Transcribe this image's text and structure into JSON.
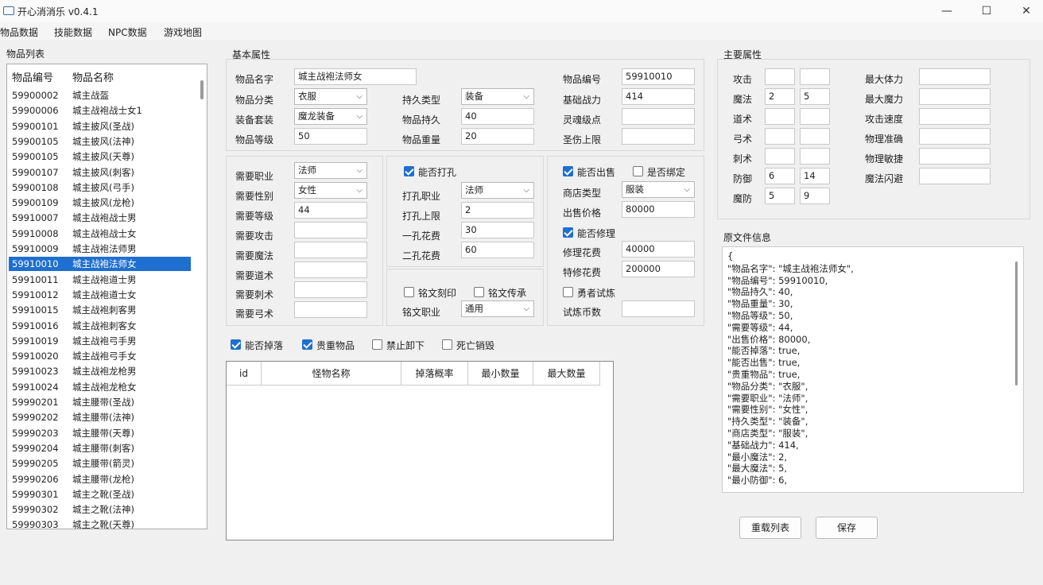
{
  "window": {
    "title": "开心消消乐 v0.4.1",
    "minimize": "—",
    "maximize": "☐",
    "close": "✕"
  },
  "menu": [
    "物品数据",
    "技能数据",
    "NPC数据",
    "游戏地图"
  ],
  "item_list": {
    "title": "物品列表",
    "headers": [
      "物品编号",
      "物品名称"
    ],
    "rows": [
      [
        "59900002",
        "城主战盔"
      ],
      [
        "59900006",
        "城主战袍战士女1"
      ],
      [
        "59900101",
        "城主披风(圣战)"
      ],
      [
        "59900105",
        "城主披风(法神)"
      ],
      [
        "59900105",
        "城主披风(天尊)"
      ],
      [
        "59900107",
        "城主披风(刺客)"
      ],
      [
        "59900108",
        "城主披风(弓手)"
      ],
      [
        "59900109",
        "城主披风(龙枪)"
      ],
      [
        "59910007",
        "城主战袍战士男"
      ],
      [
        "59910008",
        "城主战袍战士女"
      ],
      [
        "59910009",
        "城主战袍法师男"
      ],
      [
        "59910010",
        "城主战袍法师女"
      ],
      [
        "59910011",
        "城主战袍道士男"
      ],
      [
        "59910012",
        "城主战袍道士女"
      ],
      [
        "59910015",
        "城主战袍刺客男"
      ],
      [
        "59910016",
        "城主战袍刺客女"
      ],
      [
        "59910019",
        "城主战袍弓手男"
      ],
      [
        "59910020",
        "城主战袍弓手女"
      ],
      [
        "59910023",
        "城主战袍龙枪男"
      ],
      [
        "59910024",
        "城主战袍龙枪女"
      ],
      [
        "59990201",
        "城主腰带(圣战)"
      ],
      [
        "59990202",
        "城主腰带(法神)"
      ],
      [
        "59990203",
        "城主腰带(天尊)"
      ],
      [
        "59990204",
        "城主腰带(刺客)"
      ],
      [
        "59990205",
        "城主腰带(箭灵)"
      ],
      [
        "59990206",
        "城主腰带(龙枪)"
      ],
      [
        "59990301",
        "城主之靴(圣战)"
      ],
      [
        "59990302",
        "城主之靴(法神)"
      ],
      [
        "59990303",
        "城主之靴(天尊)"
      ]
    ],
    "selected_index": 11
  },
  "basic": {
    "title": "基本属性",
    "name_label": "物品名字",
    "name_value": "城主战袍法师女",
    "id_label": "物品编号",
    "id_value": "59910010",
    "category_label": "物品分类",
    "category_value": "衣服",
    "durability_type_label": "持久类型",
    "durability_type_value": "装备",
    "base_power_label": "基础战力",
    "base_power_value": "414",
    "equip_set_label": "装备套装",
    "equip_set_value": "魔龙装备",
    "durability_label": "物品持久",
    "durability_value": "40",
    "soul_label": "灵魂级点",
    "soul_value": "",
    "level_label": "物品等级",
    "level_value": "50",
    "weight_label": "物品重量",
    "weight_value": "20",
    "holy_label": "圣伤上限",
    "holy_value": ""
  },
  "req": {
    "job_label": "需要职业",
    "job_value": "法师",
    "gender_label": "需要性别",
    "gender_value": "女性",
    "level_label": "需要等级",
    "level_value": "44",
    "atk_label": "需要攻击",
    "atk_value": "",
    "magic_label": "需要魔法",
    "magic_value": "",
    "tao_label": "需要道术",
    "tao_value": "",
    "stab_label": "需要刺术",
    "stab_value": "",
    "bow_label": "需要弓术",
    "bow_value": ""
  },
  "socket": {
    "can_punch_label": "能否打孔",
    "punch_job_label": "打孔职业",
    "punch_job_value": "法师",
    "punch_max_label": "打孔上限",
    "punch_max_value": "2",
    "one_cost_label": "一孔花费",
    "one_cost_value": "30",
    "two_cost_label": "二孔花费",
    "two_cost_value": "60"
  },
  "inscription": {
    "engrave_label": "铭文刻印",
    "inherit_label": "铭文传承",
    "job_label": "铭文职业",
    "job_value": "通用"
  },
  "shop": {
    "can_sell_label": "能否出售",
    "is_bound_label": "是否绑定",
    "type_label": "商店类型",
    "type_value": "服装",
    "price_label": "出售价格",
    "price_value": "80000",
    "can_repair_label": "能否修理",
    "repair_cost_label": "修理花费",
    "repair_cost_value": "40000",
    "special_repair_label": "特修花费",
    "special_repair_value": "200000",
    "trial_label": "勇者试炼",
    "trial_coin_label": "试炼币数",
    "trial_coin_value": ""
  },
  "flags": {
    "drop": "能否掉落",
    "valuable": "贵重物品",
    "no_unequip": "禁止卸下",
    "death_destroy": "死亡销毁"
  },
  "drop_table": {
    "headers": [
      "id",
      "怪物名称",
      "掉落概率",
      "最小数量",
      "最大数量"
    ]
  },
  "main_attr": {
    "title": "主要属性",
    "rows": [
      {
        "label": "攻击",
        "a": "",
        "b": ""
      },
      {
        "label": "魔法",
        "a": "2",
        "b": "5"
      },
      {
        "label": "道术",
        "a": "",
        "b": ""
      },
      {
        "label": "弓术",
        "a": "",
        "b": ""
      },
      {
        "label": "刺术",
        "a": "",
        "b": ""
      },
      {
        "label": "防御",
        "a": "6",
        "b": "14"
      },
      {
        "label": "魔防",
        "a": "5",
        "b": "9"
      }
    ],
    "right": [
      {
        "label": "最大体力",
        "v": ""
      },
      {
        "label": "最大魔力",
        "v": ""
      },
      {
        "label": "攻击速度",
        "v": ""
      },
      {
        "label": "物理准确",
        "v": ""
      },
      {
        "label": "物理敏捷",
        "v": ""
      },
      {
        "label": "魔法闪避",
        "v": ""
      }
    ]
  },
  "source": {
    "title": "原文件信息",
    "lines": [
      "{",
      "  \"物品名字\": \"城主战袍法师女\",",
      "  \"物品编号\": 59910010,",
      "  \"物品持久\": 40,",
      "  \"物品重量\": 30,",
      "  \"物品等级\": 50,",
      "  \"需要等级\": 44,",
      "  \"出售价格\": 80000,",
      "  \"能否掉落\": true,",
      "  \"能否出售\": true,",
      "  \"贵重物品\": true,",
      "  \"物品分类\": \"衣服\",",
      "  \"需要职业\": \"法师\",",
      "  \"需要性别\": \"女性\",",
      "  \"持久类型\": \"装备\",",
      "  \"商店类型\": \"服装\",",
      "  \"基础战力\": 414,",
      "  \"最小魔法\": 2,",
      "  \"最大魔法\": 5,",
      "  \"最小防御\": 6,"
    ]
  },
  "buttons": {
    "reload": "重载列表",
    "save": "保存"
  }
}
